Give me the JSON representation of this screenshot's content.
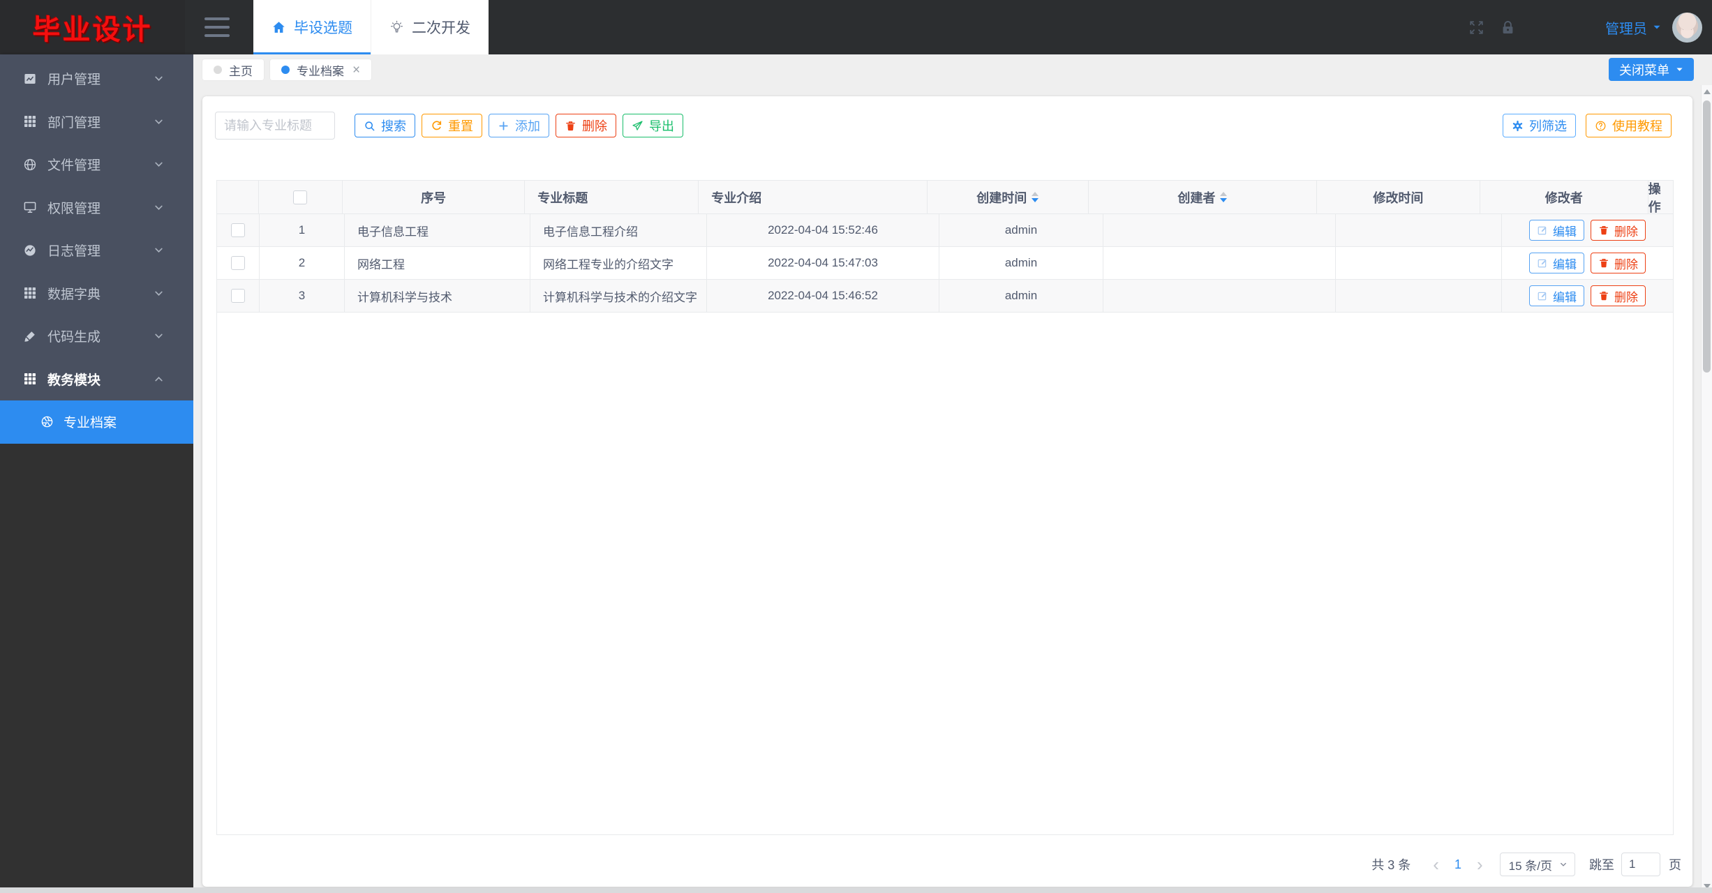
{
  "brand": {
    "logo": "毕业设计",
    "logo_color": "#ff0000"
  },
  "header": {
    "tabs": [
      {
        "label": "毕设选题",
        "icon": "home",
        "active": true
      },
      {
        "label": "二次开发",
        "icon": "bulb",
        "active": false
      }
    ],
    "user": {
      "name": "管理员"
    }
  },
  "icons": {
    "fullscreen": "expand",
    "lock": "lock",
    "user_caret": "caret-down",
    "close_menu_caret": "caret-down",
    "select_caret": "chev-sm",
    "submenu_icon": "aperture"
  },
  "sidebar": {
    "items": [
      {
        "label": "用户管理",
        "icon": "chart",
        "chevron_icon": "chev-down"
      },
      {
        "label": "部门管理",
        "icon": "grid",
        "chevron_icon": "chev-down"
      },
      {
        "label": "文件管理",
        "icon": "globe",
        "chevron_icon": "chev-down"
      },
      {
        "label": "权限管理",
        "icon": "monitor",
        "chevron_icon": "chev-down"
      },
      {
        "label": "日志管理",
        "icon": "pie",
        "chevron_icon": "chev-down"
      },
      {
        "label": "数据字典",
        "icon": "grid",
        "chevron_icon": "chev-down"
      },
      {
        "label": "代码生成",
        "icon": "brush",
        "chevron_icon": "chev-down"
      },
      {
        "label": "教务模块",
        "icon": "grid",
        "chevron_icon": "chev-up",
        "expanded": true
      }
    ],
    "submenu": {
      "label": "专业档案",
      "active": true
    }
  },
  "tabbar": {
    "chips": [
      {
        "label": "主页",
        "active": false,
        "closable": false
      },
      {
        "label": "专业档案",
        "active": true,
        "closable": true,
        "close_glyph": "×"
      }
    ],
    "close_menu": {
      "label": "关闭菜单"
    }
  },
  "toolbar": {
    "search": {
      "placeholder": "请输入专业标题"
    },
    "buttons": [
      {
        "label": "搜索",
        "icon": "search",
        "color": "blue"
      },
      {
        "label": "重置",
        "icon": "refresh",
        "color": "orange"
      },
      {
        "label": "添加",
        "icon": "plus",
        "color": "lightblue"
      },
      {
        "label": "删除",
        "icon": "trash",
        "color": "red"
      },
      {
        "label": "导出",
        "icon": "send",
        "color": "green"
      }
    ],
    "right_buttons": [
      {
        "label": "列筛选",
        "icon": "gear",
        "color": "filter"
      },
      {
        "label": "使用教程",
        "icon": "question",
        "color": "orange"
      }
    ]
  },
  "table": {
    "columns": [
      {
        "label": "",
        "type": "checkbox"
      },
      {
        "label": "序号",
        "align": "center"
      },
      {
        "label": "专业标题"
      },
      {
        "label": "专业介绍"
      },
      {
        "label": "创建时间",
        "align": "center",
        "sortable": true
      },
      {
        "label": "创建者",
        "align": "center",
        "sortable": true
      },
      {
        "label": "修改时间",
        "align": "center"
      },
      {
        "label": "修改者",
        "align": "center"
      },
      {
        "label": "操作",
        "align": "center"
      }
    ],
    "rows": [
      {
        "index": "1",
        "title": "电子信息工程",
        "intro": "电子信息工程介绍",
        "created_at": "2022-04-04 15:52:46",
        "creator": "admin",
        "modified_at": "",
        "modifier": ""
      },
      {
        "index": "2",
        "title": "网络工程",
        "intro": "网络工程专业的介绍文字",
        "created_at": "2022-04-04 15:47:03",
        "creator": "admin",
        "modified_at": "",
        "modifier": ""
      },
      {
        "index": "3",
        "title": "计算机科学与技术",
        "intro": "计算机科学与技术的介绍文字",
        "created_at": "2022-04-04 15:46:52",
        "creator": "admin",
        "modified_at": "",
        "modifier": ""
      }
    ],
    "edit_label": "编辑",
    "delete_label": "删除"
  },
  "pagination": {
    "total": "共 3 条",
    "prev_icon": "‹",
    "page": "1",
    "next_icon": "›",
    "page_size": "15 条/页",
    "jump_label": "跳至",
    "jump_value": "1",
    "unit": "页"
  },
  "colors": {
    "primary": "#2d8cf0",
    "orange": "#ff9900",
    "red": "#ed4014",
    "green": "#19be6b",
    "light_blue": "#5cadff",
    "sidebar": "#495060",
    "sidebar_dark": "#313131",
    "topbar": "#2c2e30"
  }
}
